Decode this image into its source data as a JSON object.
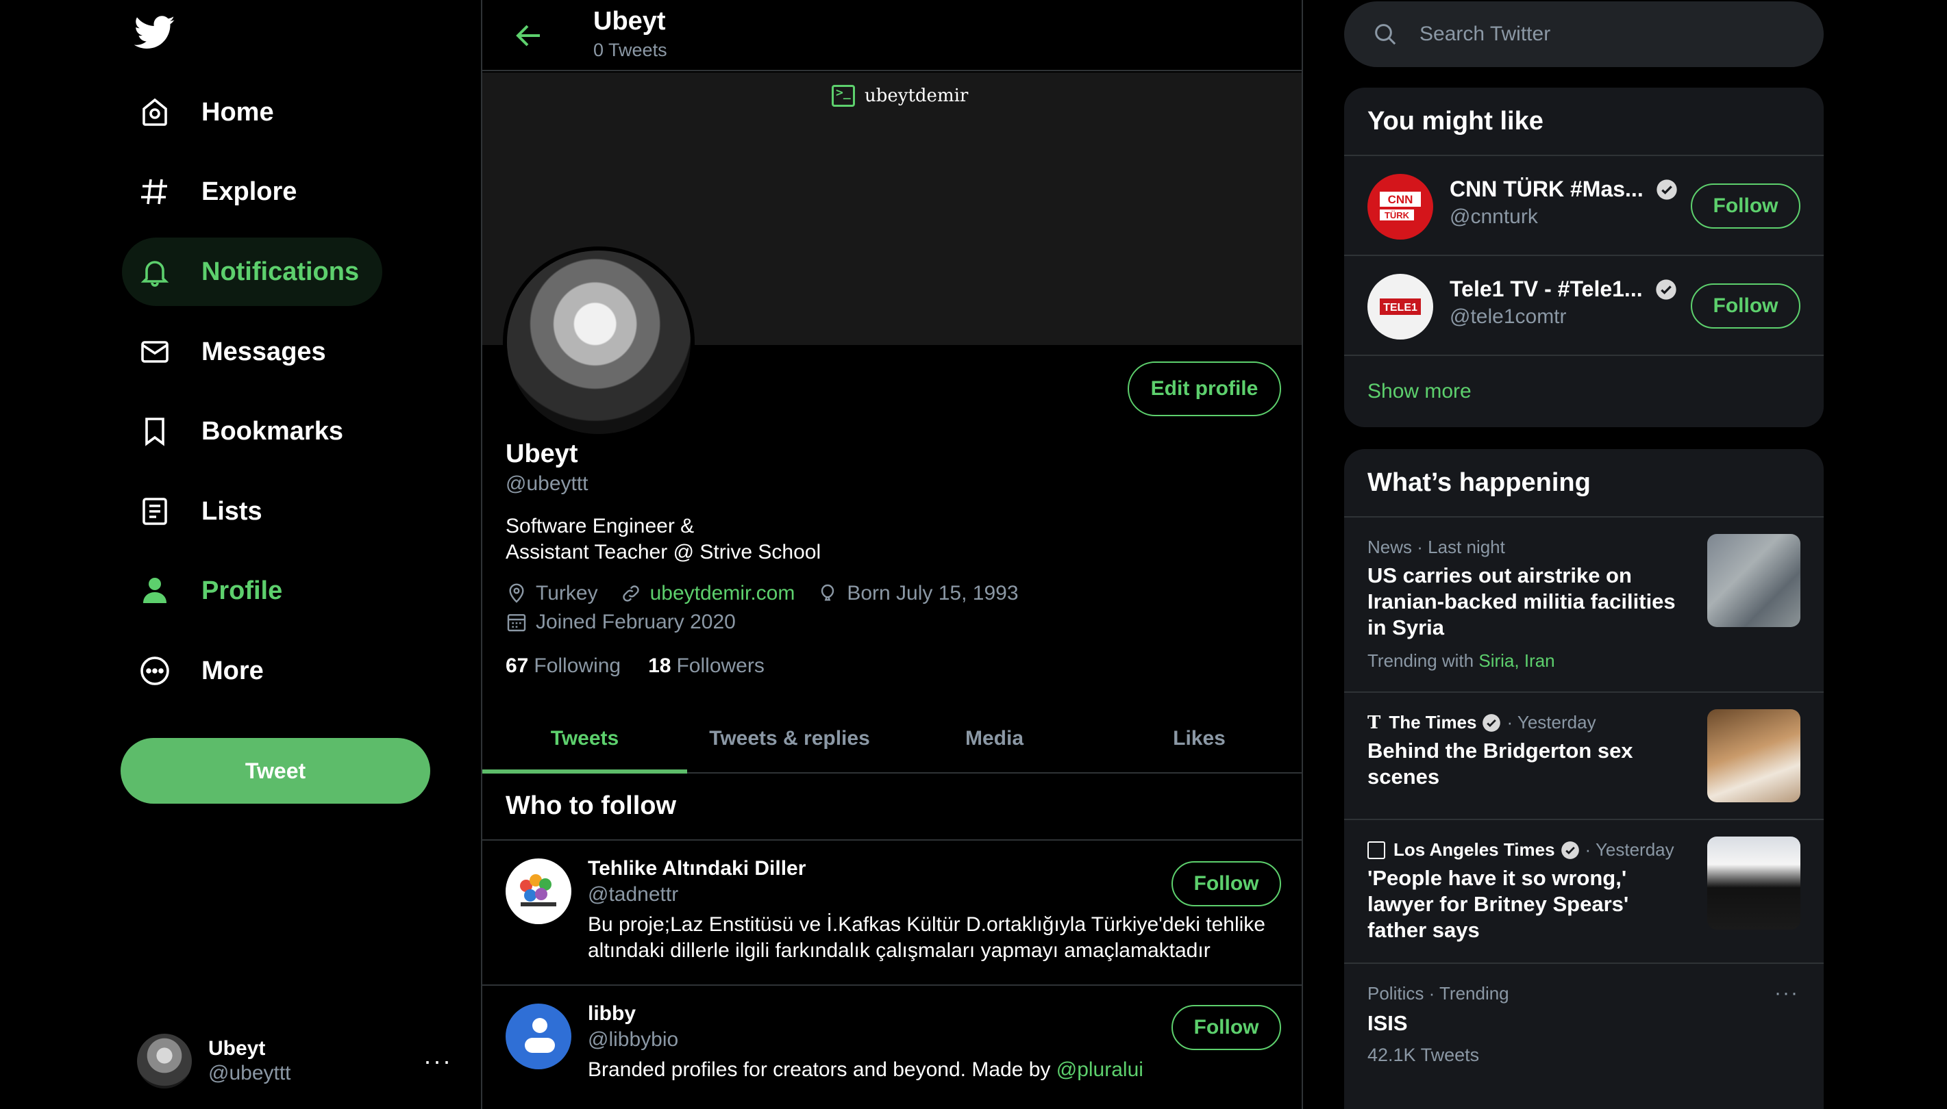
{
  "sidebar": {
    "items": [
      {
        "label": "Home",
        "icon": "home-icon"
      },
      {
        "label": "Explore",
        "icon": "hashtag-icon"
      },
      {
        "label": "Notifications",
        "icon": "bell-icon"
      },
      {
        "label": "Messages",
        "icon": "envelope-icon"
      },
      {
        "label": "Bookmarks",
        "icon": "bookmark-icon"
      },
      {
        "label": "Lists",
        "icon": "list-icon"
      },
      {
        "label": "Profile",
        "icon": "person-icon"
      },
      {
        "label": "More",
        "icon": "more-circle-icon"
      }
    ],
    "tweet_label": "Tweet",
    "account": {
      "name": "Ubeyt",
      "handle": "@ubeyttt",
      "more": "···"
    }
  },
  "header": {
    "name": "Ubeyt",
    "tweet_count": "0 Tweets"
  },
  "banner": {
    "tag": "ubeytdemir"
  },
  "profile": {
    "edit_label": "Edit profile",
    "name": "Ubeyt",
    "handle": "@ubeyttt",
    "bio_line1": "Software Engineer &",
    "bio_line2": "Assistant Teacher @ Strive School",
    "location": "Turkey",
    "website": "ubeytdemir.com",
    "born": "Born July 15, 1993",
    "joined": "Joined February 2020",
    "following_count": "67",
    "following_label": "Following",
    "followers_count": "18",
    "followers_label": "Followers"
  },
  "tabs": [
    "Tweets",
    "Tweets & replies",
    "Media",
    "Likes"
  ],
  "who_to_follow": {
    "title": "Who to follow",
    "accounts": [
      {
        "name": "Tehlike Altındaki Diller",
        "handle": "@tadnettr",
        "bio": "Bu proje;Laz Enstitüsü ve İ.Kafkas Kültür D.ortaklığıyla Türkiye'deki tehlike altındaki dillerle ilgili farkındalık çalışmaları yapmayı amaçlamaktadır",
        "follow_label": "Follow"
      },
      {
        "name": "libby",
        "handle": "@libbybio",
        "bio": "Branded profiles for creators and beyond. Made by ",
        "mention": "@pluralui",
        "follow_label": "Follow"
      }
    ]
  },
  "search": {
    "placeholder": "Search Twitter"
  },
  "you_might_like": {
    "title": "You might like",
    "accounts": [
      {
        "name": "CNN TÜRK #Mas...",
        "handle": "@cnnturk",
        "follow_label": "Follow",
        "logo_text": "CNN TÜRK"
      },
      {
        "name": "Tele1 TV - #Tele1...",
        "handle": "@tele1comtr",
        "follow_label": "Follow",
        "logo_text": "TELE1"
      }
    ],
    "show_more": "Show more"
  },
  "whats_happening": {
    "title": "What’s happening",
    "trends": [
      {
        "meta": "News · Last night",
        "title": "US carries out airstrike on Iranian-backed militia facilities in Syria",
        "trending_with": "Trending with",
        "tags": [
          "Siria",
          "Iran"
        ]
      },
      {
        "source": "The Times",
        "time": "· Yesterday",
        "title": "Behind the Bridgerton sex scenes"
      },
      {
        "source": "Los Angeles Times",
        "time": "· Yesterday",
        "title": "'People have it so wrong,' lawyer for Britney Spears' father says"
      },
      {
        "meta": "Politics · Trending",
        "title": "ISIS",
        "count": "42.1K Tweets",
        "more": "···"
      }
    ]
  },
  "colors": {
    "accent": "#5dd06d",
    "button": "#5dbc6a",
    "muted": "#8b98a5",
    "card": "#16181c",
    "border": "#2f3336"
  }
}
